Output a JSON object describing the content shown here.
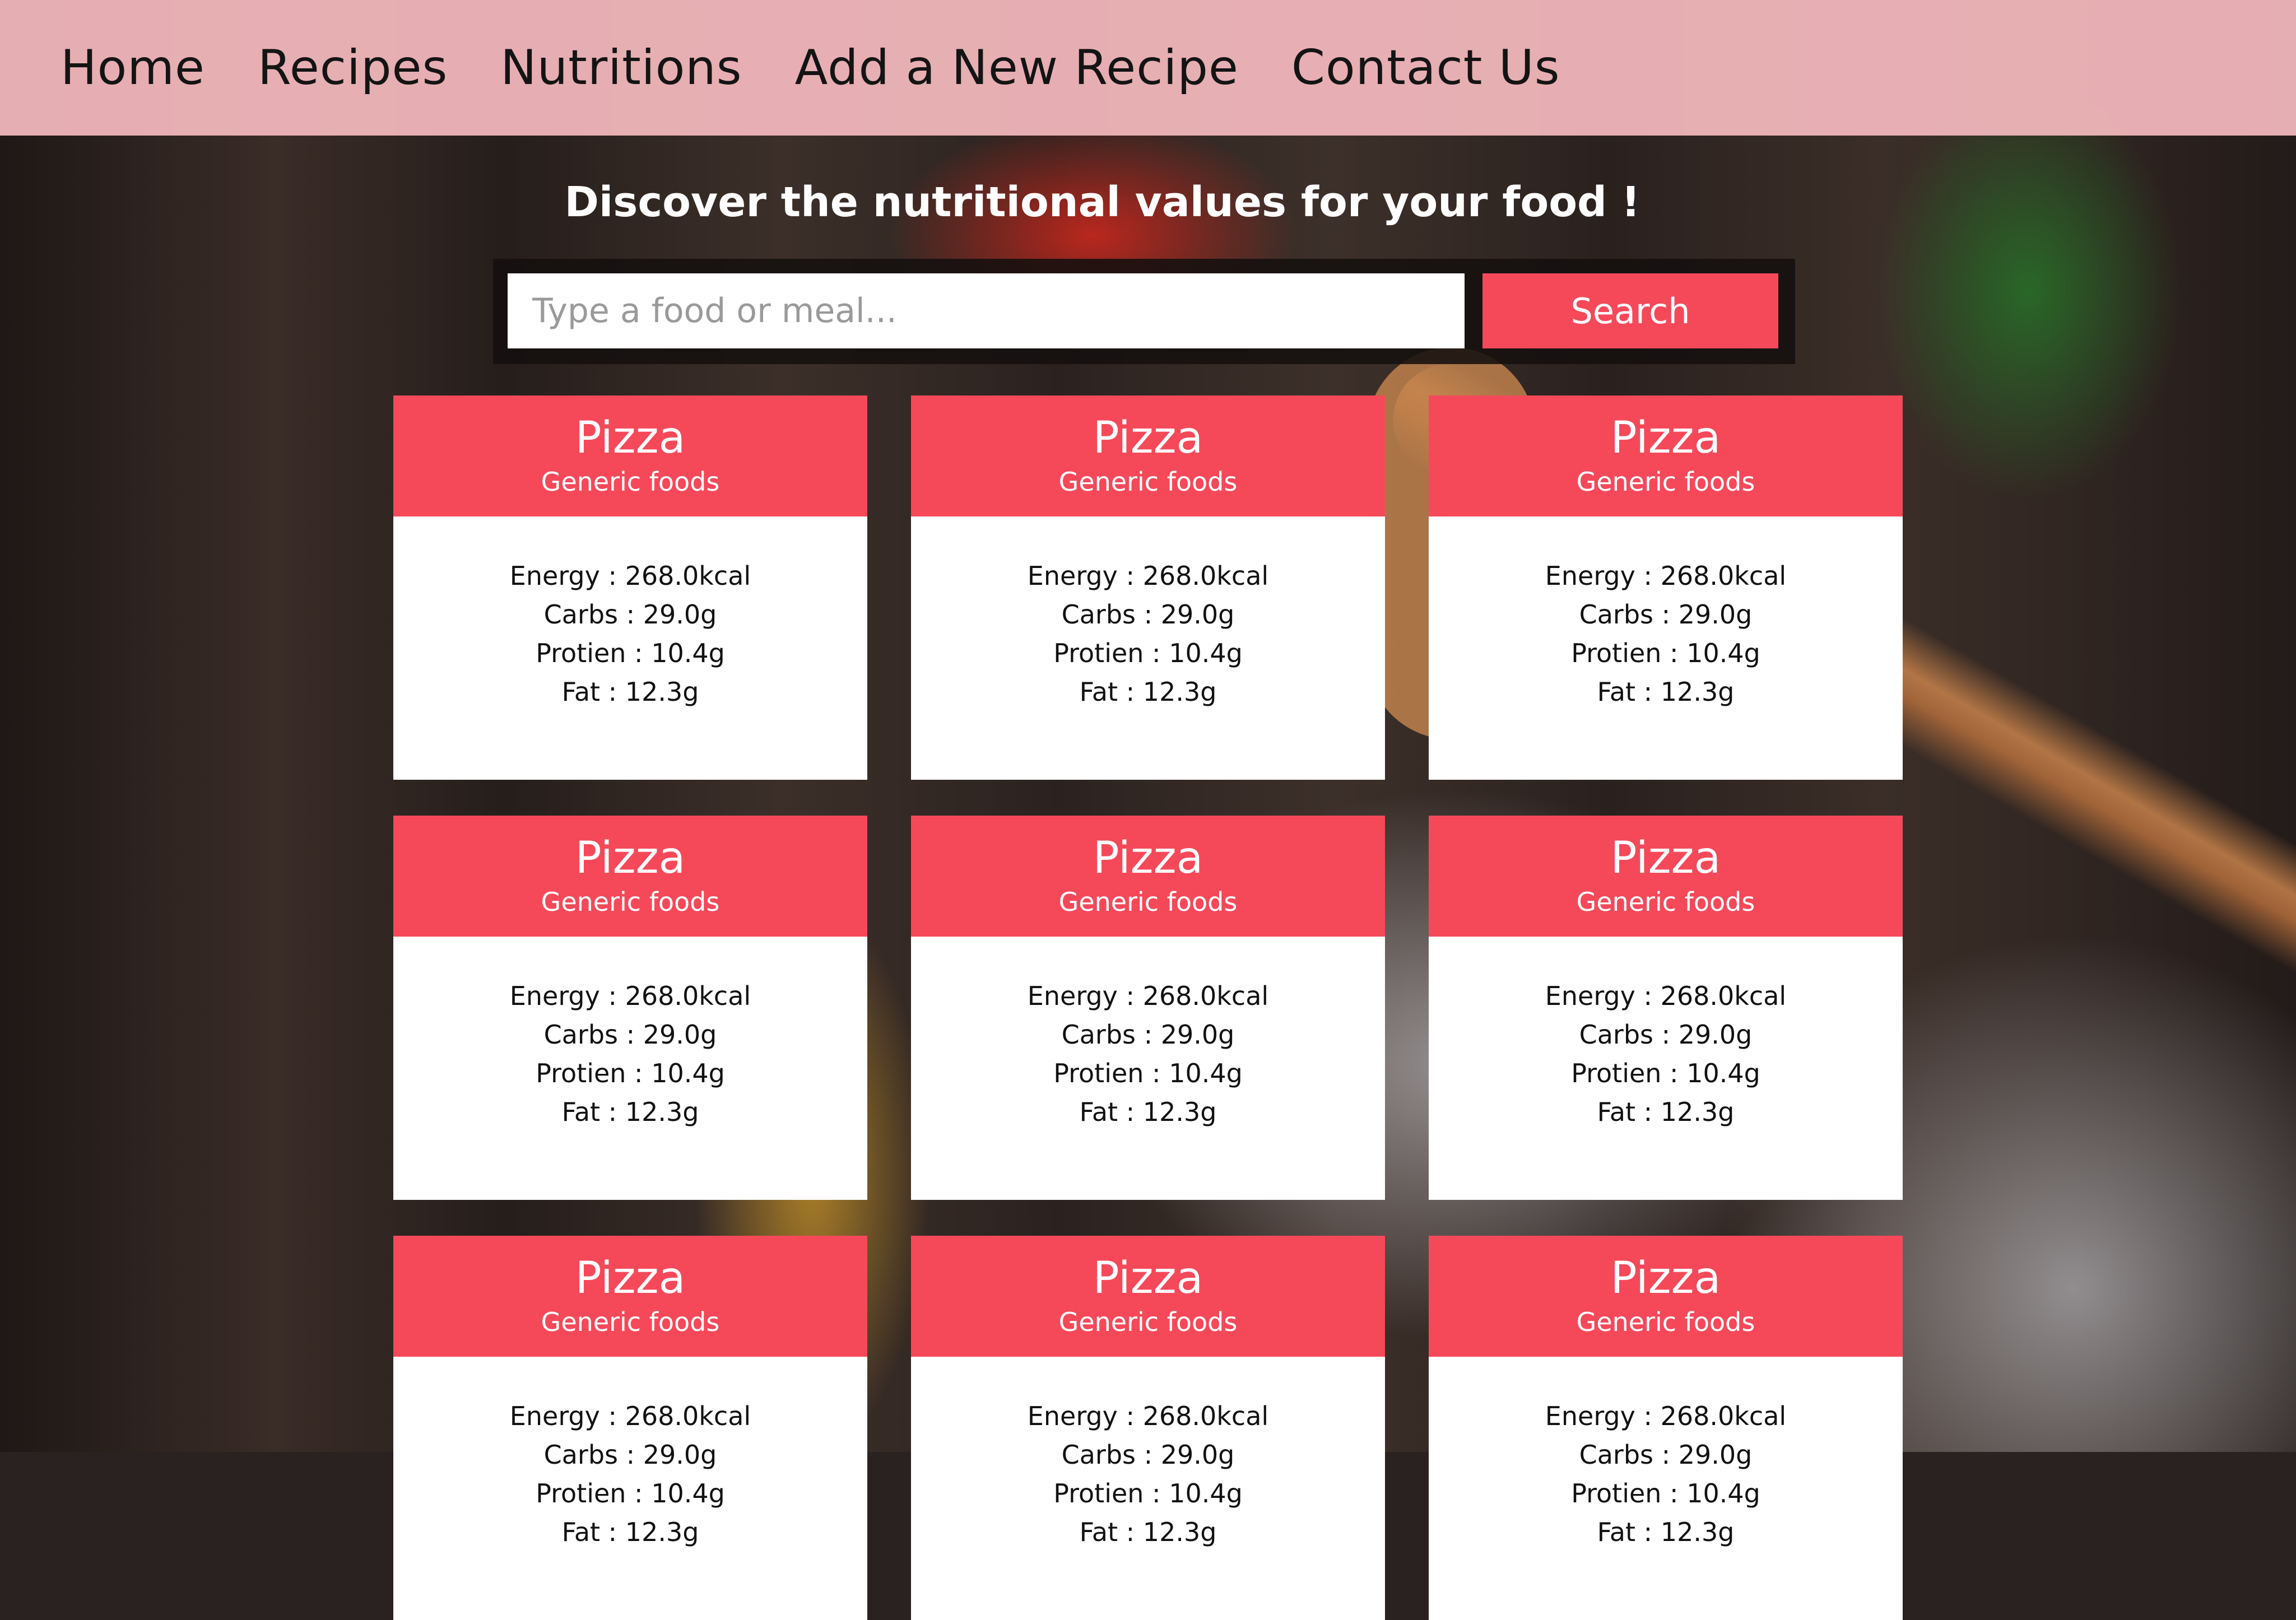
{
  "nav": {
    "items": [
      "Home",
      "Recipes",
      "Nutritions",
      "Add a New Recipe",
      "Contact Us"
    ]
  },
  "headline": "Discover the nutritional values for your food !",
  "search": {
    "placeholder": "Type a food or meal...",
    "value": "",
    "button_label": "Search"
  },
  "labels": {
    "energy": "Energy",
    "carbs": "Carbs",
    "protein": "Protien",
    "fat": "Fat",
    "sep": " : "
  },
  "cards": [
    {
      "title": "Pizza",
      "subtitle": "Generic foods",
      "energy": "268.0kcal",
      "carbs": "29.0g",
      "protein": "10.4g",
      "fat": "12.3g"
    },
    {
      "title": "Pizza",
      "subtitle": "Generic foods",
      "energy": "268.0kcal",
      "carbs": "29.0g",
      "protein": "10.4g",
      "fat": "12.3g"
    },
    {
      "title": "Pizza",
      "subtitle": "Generic foods",
      "energy": "268.0kcal",
      "carbs": "29.0g",
      "protein": "10.4g",
      "fat": "12.3g"
    },
    {
      "title": "Pizza",
      "subtitle": "Generic foods",
      "energy": "268.0kcal",
      "carbs": "29.0g",
      "protein": "10.4g",
      "fat": "12.3g"
    },
    {
      "title": "Pizza",
      "subtitle": "Generic foods",
      "energy": "268.0kcal",
      "carbs": "29.0g",
      "protein": "10.4g",
      "fat": "12.3g"
    },
    {
      "title": "Pizza",
      "subtitle": "Generic foods",
      "energy": "268.0kcal",
      "carbs": "29.0g",
      "protein": "10.4g",
      "fat": "12.3g"
    },
    {
      "title": "Pizza",
      "subtitle": "Generic foods",
      "energy": "268.0kcal",
      "carbs": "29.0g",
      "protein": "10.4g",
      "fat": "12.3g"
    },
    {
      "title": "Pizza",
      "subtitle": "Generic foods",
      "energy": "268.0kcal",
      "carbs": "29.0g",
      "protein": "10.4g",
      "fat": "12.3g"
    },
    {
      "title": "Pizza",
      "subtitle": "Generic foods",
      "energy": "268.0kcal",
      "carbs": "29.0g",
      "protein": "10.4g",
      "fat": "12.3g"
    }
  ],
  "colors": {
    "accent": "#f5495a",
    "nav_background": "#f0b6ba",
    "card_background": "#ffffff"
  }
}
